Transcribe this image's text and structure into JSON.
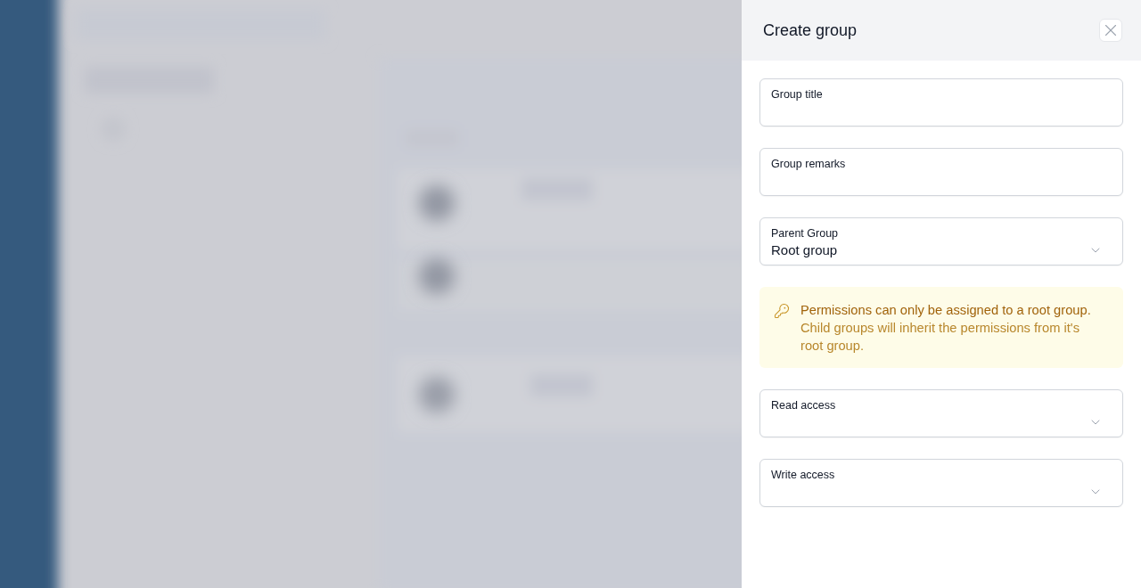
{
  "drawer": {
    "title": "Create group"
  },
  "form": [
    {
      "kind": "text",
      "label": "Group title"
    },
    {
      "kind": "text",
      "label": "Group remarks"
    },
    {
      "kind": "select",
      "label": "Parent Group",
      "value": "Root group"
    },
    {
      "kind": "notice",
      "title": "Permissions can only be assigned to a root group.",
      "text": "Child groups will inherit the permissions from it's root group."
    },
    {
      "kind": "select",
      "label": "Read access"
    },
    {
      "kind": "select",
      "label": "Write access"
    }
  ]
}
